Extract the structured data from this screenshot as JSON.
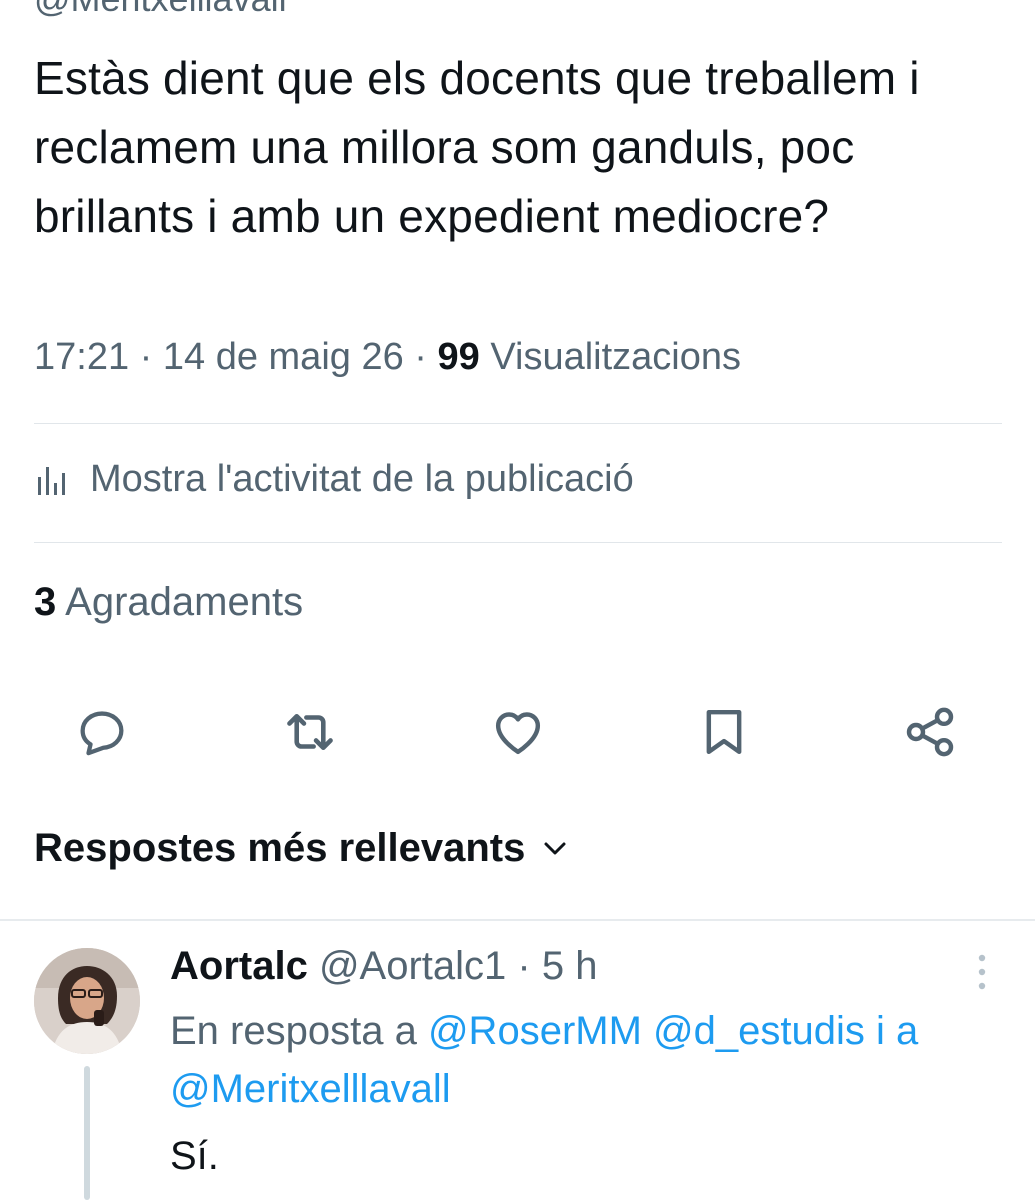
{
  "header": {
    "handle_partial": "@Meritxelllavall"
  },
  "tweet": {
    "text": "Estàs dient que els docents que treballem i reclamem una millora som ganduls, poc brillants i amb un expedient mediocre?",
    "time": "17:21",
    "date": "14 de maig 26",
    "separator": "·",
    "views_count": "99",
    "views_label": "Visualitzacions",
    "activity_label": "Mostra l'activitat de la publicació",
    "likes_count": "3",
    "likes_label": "Agradaments"
  },
  "actions": {
    "icons": [
      "reply-icon",
      "retweet-icon",
      "like-icon",
      "bookmark-icon",
      "share-icon"
    ]
  },
  "replies_sort": {
    "label": "Respostes més rellevants"
  },
  "reply": {
    "name": "Aortalc",
    "handle": "@Aortalc1",
    "separator": "·",
    "time": "5 h",
    "reply_to_prefix": "En resposta a",
    "mention1": "@RoserMM",
    "mention2": "@d_estudis",
    "conj1": "i",
    "conj2": "a",
    "mention3": "@Meritxelllavall",
    "text": "Sí."
  },
  "colors": {
    "text": "#0f1419",
    "secondary": "#536471",
    "accent": "#1d9bf0",
    "divider": "#e1e6ea"
  }
}
